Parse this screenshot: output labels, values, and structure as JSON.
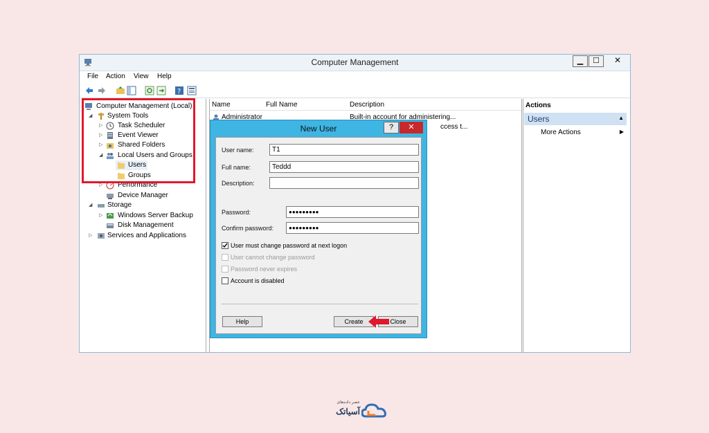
{
  "window": {
    "title": "Computer Management",
    "min": "▁",
    "max": "☐",
    "close": "✕"
  },
  "menu": [
    "File",
    "Action",
    "View",
    "Help"
  ],
  "tree": {
    "root": "Computer Management (Local)",
    "system_tools": "System Tools",
    "task_scheduler": "Task Scheduler",
    "event_viewer": "Event Viewer",
    "shared_folders": "Shared Folders",
    "local_users_groups": "Local Users and Groups",
    "users": "Users",
    "groups": "Groups",
    "performance": "Performance",
    "device_manager": "Device Manager",
    "storage": "Storage",
    "wsb": "Windows Server Backup",
    "disk_mgmt": "Disk Management",
    "services_apps": "Services and Applications"
  },
  "list": {
    "columns": [
      "Name",
      "Full Name",
      "Description"
    ],
    "rows": [
      {
        "name": "Administrator",
        "full_name": "",
        "description": "Built-in account for administering..."
      },
      {
        "name": "",
        "full_name": "",
        "description": "ccess t..."
      }
    ]
  },
  "actions": {
    "header": "Actions",
    "section": "Users",
    "more": "More Actions"
  },
  "dialog": {
    "title": "New User",
    "help_q": "?",
    "close_x": "✕",
    "user_name_label": "User name:",
    "user_name_value": "T1",
    "full_name_label": "Full name:",
    "full_name_value": "Teddd",
    "description_label": "Description:",
    "description_value": "",
    "password_label": "Password:",
    "password_value": "●●●●●●●●●",
    "confirm_label": "Confirm password:",
    "confirm_value": "●●●●●●●●●",
    "checkboxes": [
      {
        "label": "User must change password at next logon",
        "checked": true,
        "enabled": true
      },
      {
        "label": "User cannot change password",
        "checked": false,
        "enabled": false
      },
      {
        "label": "Password never expires",
        "checked": false,
        "enabled": false
      },
      {
        "label": "Account is disabled",
        "checked": false,
        "enabled": true
      }
    ],
    "help_button": "Help",
    "create_button": "Create",
    "close_button": "Close"
  },
  "brand": {
    "logo_text": "آسیاتک",
    "logo_subtitle": "عصر داده‌های"
  },
  "colors": {
    "accent_red": "#e0182b",
    "dialog_blue": "#3eb5e3",
    "logo_orange": "#f07d2a",
    "logo_blue": "#2d6fb6"
  }
}
